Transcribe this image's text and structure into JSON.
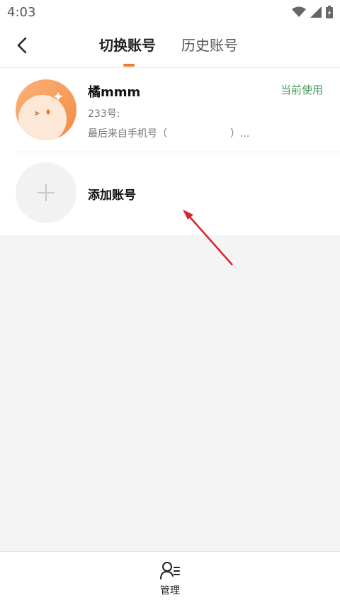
{
  "status_bar": {
    "time": "4:03"
  },
  "header": {
    "tabs": [
      {
        "label": "切换账号",
        "active": true
      },
      {
        "label": "历史账号",
        "active": false
      }
    ],
    "accent_color": "#f07b2e"
  },
  "accounts": [
    {
      "name": "橘mmm",
      "id_label": "233号:",
      "last_source": "最后来自手机号（                    ）...",
      "status": "当前使用",
      "status_color": "#4a9b60"
    }
  ],
  "add_account": {
    "label": "添加账号"
  },
  "bottom": {
    "manage_label": "管理"
  },
  "icons": {
    "back": "chevron-left-icon",
    "add": "plus-icon",
    "manage": "user-list-icon",
    "wifi": "wifi-icon",
    "signal": "signal-icon",
    "battery": "battery-icon"
  }
}
